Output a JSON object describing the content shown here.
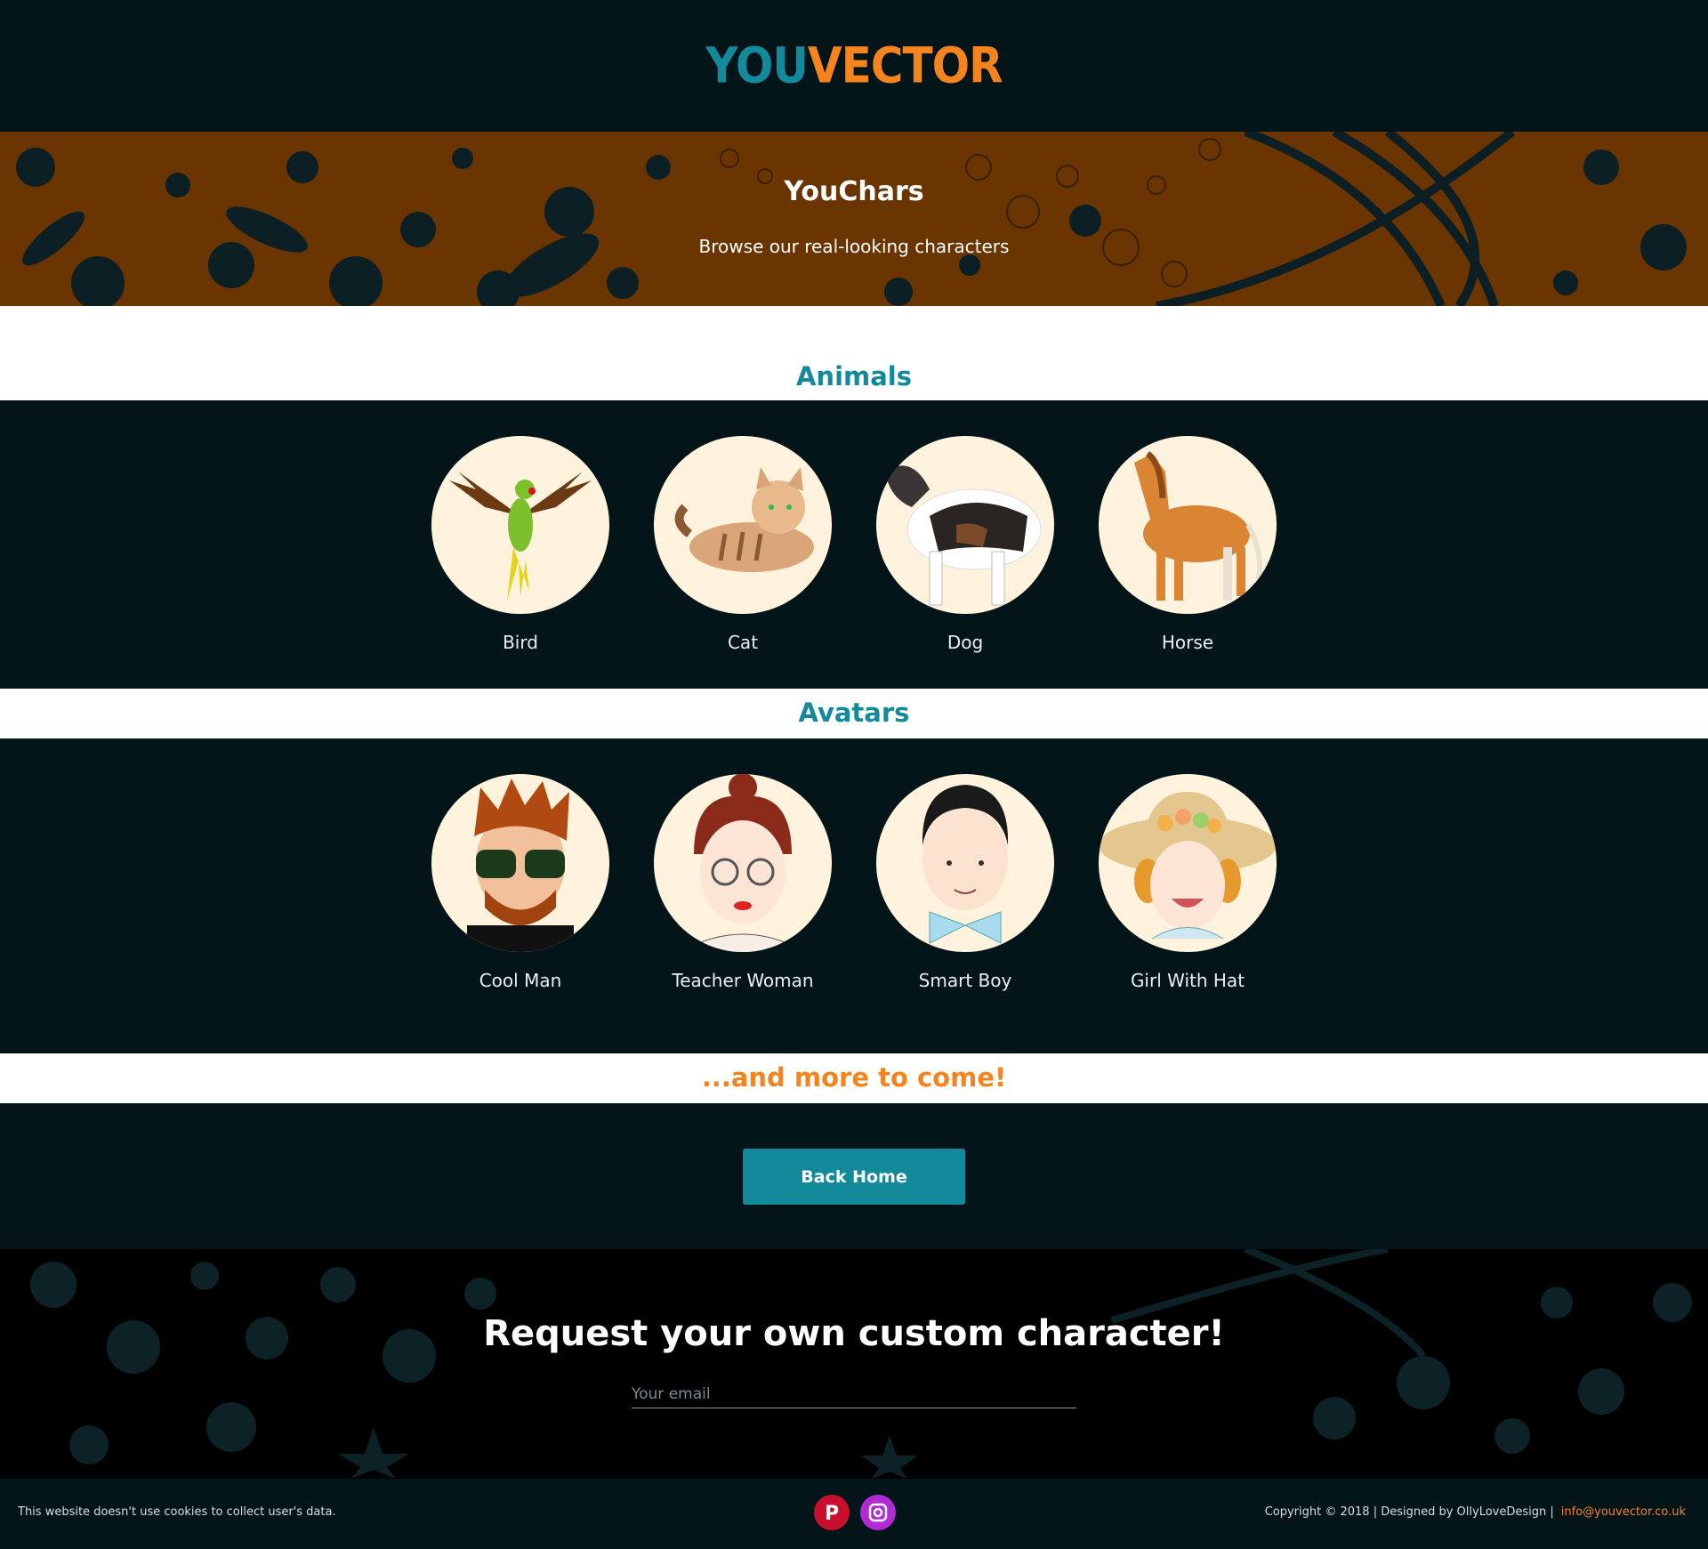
{
  "brand": {
    "part1": "YOU",
    "part2": "VECTOR"
  },
  "hero": {
    "title": "YouChars",
    "subtitle": "Browse our real-looking characters"
  },
  "sections": {
    "animals": {
      "title": "Animals",
      "items": [
        {
          "label": "Bird",
          "icon": "bird-icon"
        },
        {
          "label": "Cat",
          "icon": "cat-icon"
        },
        {
          "label": "Dog",
          "icon": "dog-icon"
        },
        {
          "label": "Horse",
          "icon": "horse-icon"
        }
      ]
    },
    "avatars": {
      "title": "Avatars",
      "items": [
        {
          "label": "Cool Man",
          "icon": "cool-man-avatar"
        },
        {
          "label": "Teacher Woman",
          "icon": "teacher-woman-avatar"
        },
        {
          "label": "Smart Boy",
          "icon": "smart-boy-avatar"
        },
        {
          "label": "Girl With Hat",
          "icon": "girl-with-hat-avatar"
        }
      ]
    }
  },
  "more": "...and more to come!",
  "back_home": "Back Home",
  "request": {
    "title": "Request your own custom character!",
    "email_placeholder": "Your email"
  },
  "footer": {
    "cookie_text": "This website doesn't use cookies to collect user's data.",
    "copyright": "Copyright © 2018 | Designed by OllyLoveDesign |",
    "email": "info@youvector.co.uk",
    "social": [
      "pinterest-icon",
      "instagram-icon"
    ]
  },
  "colors": {
    "teal": "#138a9b",
    "orange": "#f5841f",
    "dark": "#04151a",
    "hero_brown": "#6a3500"
  }
}
